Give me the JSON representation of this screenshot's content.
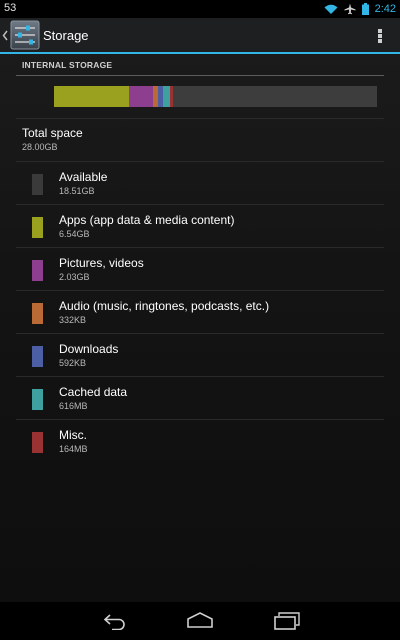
{
  "status_bar": {
    "left_text": "53",
    "time": "2:42",
    "icons": [
      "wifi-icon",
      "airplane-icon",
      "battery-icon"
    ]
  },
  "action_bar": {
    "title": "Storage",
    "icon": "settings-sliders-icon",
    "accent_color": "#33b5e5"
  },
  "section": {
    "label": "INTERNAL STORAGE"
  },
  "usage_bar": {
    "segments": [
      {
        "name": "Apps (app data & media content)",
        "percent": 23.36,
        "color": "#9aa11f"
      },
      {
        "name": "Pictures, videos",
        "percent": 7.25,
        "color": "#8e3e8e"
      },
      {
        "name": "Audio (music, ringtones, podcasts, etc.)",
        "percent": 1.5,
        "color": "#b96a35"
      },
      {
        "name": "Downloads",
        "percent": 1.5,
        "color": "#4c5ea4"
      },
      {
        "name": "Cached data",
        "percent": 2.2,
        "color": "#3fa0a0"
      },
      {
        "name": "Misc.",
        "percent": 0.9,
        "color": "#993333"
      }
    ],
    "available_color": "#3d3d3d"
  },
  "total": {
    "label": "Total space",
    "value": "28.00GB"
  },
  "categories": [
    {
      "label": "Available",
      "size": "18.51GB",
      "color": "#3a3a3a"
    },
    {
      "label": "Apps (app data & media content)",
      "size": "6.54GB",
      "color": "#9aa11f"
    },
    {
      "label": "Pictures, videos",
      "size": "2.03GB",
      "color": "#8e3e8e"
    },
    {
      "label": "Audio (music, ringtones, podcasts, etc.)",
      "size": "332KB",
      "color": "#b96a35"
    },
    {
      "label": "Downloads",
      "size": "592KB",
      "color": "#4c5ea4"
    },
    {
      "label": "Cached data",
      "size": "616MB",
      "color": "#3fa0a0"
    },
    {
      "label": "Misc.",
      "size": "164MB",
      "color": "#993333"
    }
  ],
  "nav_bar": {
    "buttons": [
      "back-icon",
      "home-icon",
      "recents-icon"
    ]
  }
}
